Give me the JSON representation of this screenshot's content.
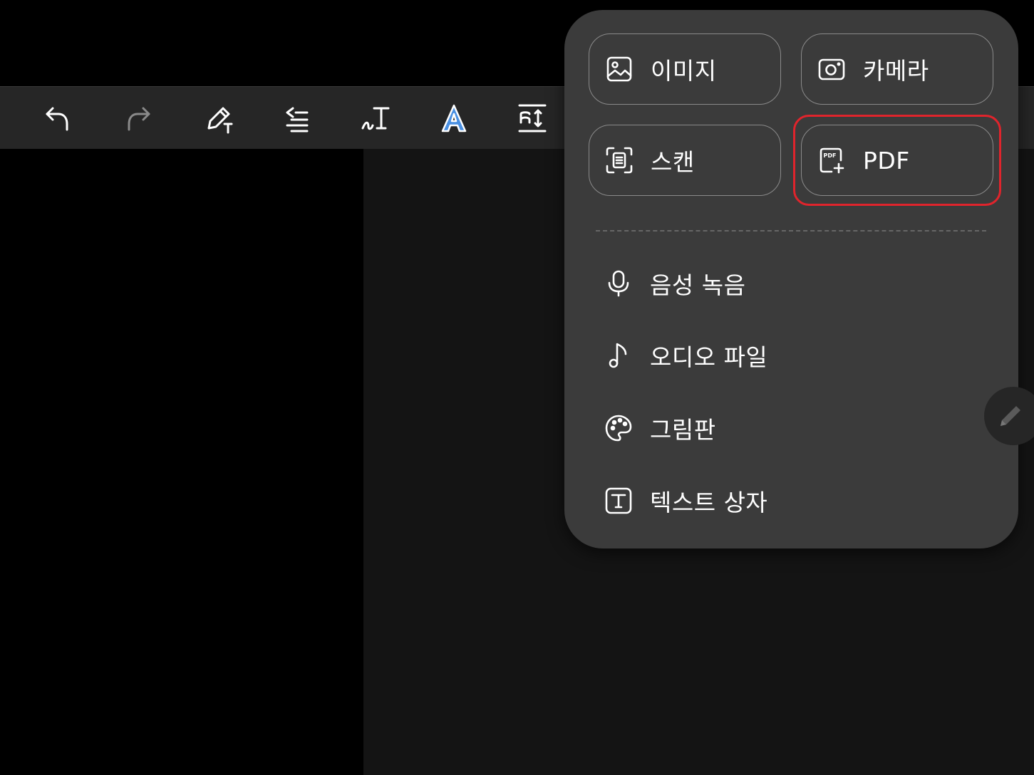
{
  "toolbar": {
    "buttons": [
      {
        "name": "undo",
        "icon": "undo-icon"
      },
      {
        "name": "redo",
        "icon": "redo-icon"
      },
      {
        "name": "pen-settings",
        "icon": "pen-icon"
      },
      {
        "name": "text-align",
        "icon": "align-icon"
      },
      {
        "name": "handwriting-to-text",
        "icon": "handwriting-text-icon"
      },
      {
        "name": "text-style",
        "icon": "text-style-icon",
        "accent": "#4a90e2"
      },
      {
        "name": "line-spacing",
        "icon": "line-spacing-icon"
      }
    ]
  },
  "insert_menu": {
    "tiles": [
      {
        "label": "이미지",
        "icon": "image-icon"
      },
      {
        "label": "카메라",
        "icon": "camera-icon"
      },
      {
        "label": "스캔",
        "icon": "scan-icon"
      },
      {
        "label": "PDF",
        "icon": "pdf-add-icon",
        "highlighted": true
      }
    ],
    "items": [
      {
        "label": "음성 녹음",
        "icon": "microphone-icon"
      },
      {
        "label": "오디오 파일",
        "icon": "music-note-icon"
      },
      {
        "label": "그림판",
        "icon": "palette-icon"
      },
      {
        "label": "텍스트 상자",
        "icon": "text-box-icon"
      }
    ]
  },
  "colors": {
    "background": "#000000",
    "toolbar": "#262626",
    "popup": "#3b3b3b",
    "highlight": "#e0242c"
  }
}
